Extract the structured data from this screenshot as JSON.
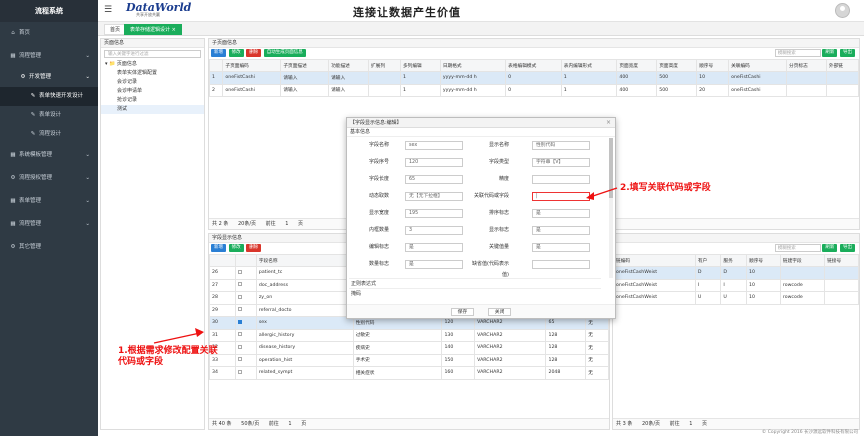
{
  "app": {
    "title": "流程系统",
    "logo_main": "DataWorld",
    "logo_sub": "共享开放共赢",
    "slogan": "连接让数据产生价值",
    "footer": "© Copyright 2016 长沙源远软件科技有限公司"
  },
  "sidebar": {
    "items": [
      {
        "label": "首页"
      },
      {
        "label": "流程管理"
      },
      {
        "label": "开发管理"
      },
      {
        "label": "表单快速开发设计"
      },
      {
        "label": "表单设计"
      },
      {
        "label": "流程设计"
      },
      {
        "label": "系统模板管理"
      },
      {
        "label": "流程授权管理"
      },
      {
        "label": "表单管理"
      },
      {
        "label": "流程管理"
      },
      {
        "label": "其它管理"
      }
    ]
  },
  "tabs": [
    {
      "label": "首页"
    },
    {
      "label": "表单存储逻辑设计 ×"
    }
  ],
  "left": {
    "title": "页面信息",
    "search_placeholder": "输入关键字进行过滤",
    "tree": [
      "页面信息",
      "表单实体逻辑配置",
      "会诊记录",
      "会诊申请单",
      "抢诊记录",
      "测试"
    ]
  },
  "top": {
    "title": "子页面信息",
    "buttons": [
      "新增",
      "修改",
      "删除",
      "自动生成页面信息"
    ],
    "search_placeholder": "模糊搜索",
    "right_buttons": [
      "刷新",
      "导出"
    ],
    "columns": [
      "",
      "子页面编码",
      "子页面描述",
      "功能描述",
      "扩展列",
      "多列编辑",
      "日期格式",
      "表格编辑模式",
      "表内编辑形式",
      "页面宽度",
      "页面高度",
      "顺序号",
      "关联编码",
      "分页标志",
      "外部链"
    ],
    "rows": [
      [
        "1",
        "oneFistCashi",
        "请输入",
        "请输入",
        "",
        "1",
        "yyyy-mm-dd h",
        "0",
        "1",
        "400",
        "500",
        "10",
        "oneFistCashi",
        "",
        ""
      ],
      [
        "2",
        "oneFistCashi",
        "请输入",
        "请输入",
        "",
        "1",
        "yyyy-mm-dd h",
        "0",
        "1",
        "400",
        "500",
        "20",
        "oneFistCashi",
        "",
        ""
      ]
    ],
    "pager": [
      "共 2 条",
      "20条/页",
      "前往",
      "1",
      "页"
    ]
  },
  "bottom": {
    "title": "字段显示信息",
    "buttons": [
      "新增",
      "修改",
      "删除"
    ],
    "search_placeholder": "模糊搜索",
    "columns": [
      "",
      "",
      "字段名称",
      "显示名称",
      "",
      "",
      "",
      ""
    ],
    "rows": [
      [
        "26",
        "",
        "patient_tc",
        "患者标志",
        "",
        "",
        "",
        ""
      ],
      [
        "27",
        "",
        "doc_address",
        "对话词文档地址",
        "",
        "",
        "",
        ""
      ],
      [
        "28",
        "",
        "zy_on",
        "住院号",
        "",
        "",
        "",
        ""
      ],
      [
        "29",
        "",
        "referral_docto",
        "转诊医师姓名",
        "",
        "",
        "",
        ""
      ],
      [
        "30",
        "on",
        "sex",
        "性别代码",
        "120",
        "VARCHAR2",
        "65",
        "无"
      ],
      [
        "31",
        "",
        "allergic_history",
        "过敏史",
        "130",
        "VARCHAR2",
        "128",
        "无"
      ],
      [
        "32",
        "",
        "disease_history",
        "疾病史",
        "140",
        "VARCHAR2",
        "128",
        "无"
      ],
      [
        "33",
        "",
        "operation_hist",
        "手术史",
        "150",
        "VARCHAR2",
        "128",
        "无"
      ],
      [
        "34",
        "",
        "related_sympt",
        "相关症状",
        "160",
        "VARCHAR2",
        "2048",
        "无"
      ]
    ],
    "pager": [
      "共 40 条",
      "50条/页",
      "前往",
      "1",
      "页"
    ]
  },
  "bottom_right": {
    "buttons": [
      "刷新",
      "导出"
    ],
    "search_placeholder": "模糊搜索",
    "columns": [
      "链编码",
      "有户",
      "服务",
      "顺序号",
      "链建字段",
      "链接号"
    ],
    "rows": [
      [
        "oneFistCashWeist",
        "D",
        "D",
        "10",
        "",
        ""
      ],
      [
        "oneFistCashWeist",
        "I",
        "I",
        "10",
        "rowcode",
        ""
      ],
      [
        "oneFistCashWeist",
        "U",
        "U",
        "10",
        "rowcode",
        ""
      ]
    ],
    "pager": [
      "共 3 条",
      "20条/页",
      "前往",
      "1",
      "页"
    ]
  },
  "modal": {
    "title": "【字段显示信息:编辑】",
    "section": "基本信息",
    "fields": [
      {
        "label": "字段名称",
        "value": "sex"
      },
      {
        "label": "显示名称",
        "value": "性别代码"
      },
      {
        "label": "字段序号",
        "value": "120"
      },
      {
        "label": "字段类型",
        "value": "字符串【V】"
      },
      {
        "label": "字段长度",
        "value": "65"
      },
      {
        "label": "精度",
        "value": ""
      },
      {
        "label": "动态取数",
        "value": "无【无下拉框】"
      },
      {
        "label": "关联代码或字段",
        "value": "|"
      },
      {
        "label": "显示宽度",
        "value": "195"
      },
      {
        "label": "排序标志",
        "value": "是"
      },
      {
        "label": "内框数量",
        "value": "3"
      },
      {
        "label": "显示标志",
        "value": "是"
      },
      {
        "label": "编辑标志",
        "value": "是"
      },
      {
        "label": "关键值量",
        "value": "是"
      },
      {
        "label": "数量标志",
        "value": "是"
      },
      {
        "label": "缺省值(代码表示值)",
        "value": ""
      }
    ],
    "textareas": [
      "正则表达式",
      "掩码"
    ],
    "save": "保存",
    "close": "关闭"
  },
  "annotations": {
    "a1": "1.根据需求修改配置关联代码或字段",
    "a2": "2.填写关联代码或字段"
  },
  "colors": {
    "sidebar": "#2f3a44",
    "accent": "#1aad5b",
    "primary": "#2a7fd4",
    "danger": "#d9362b",
    "annotation": "#e11111"
  }
}
